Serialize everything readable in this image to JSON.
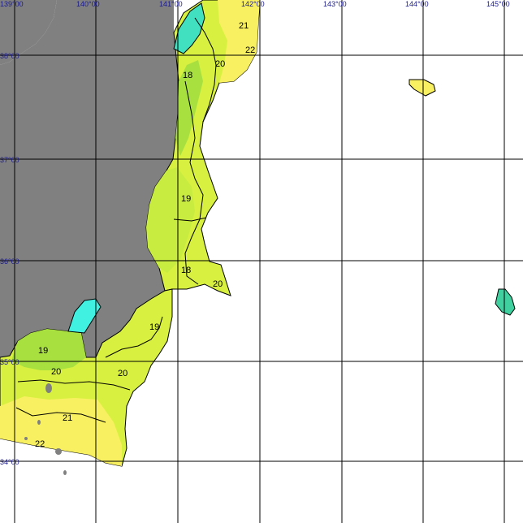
{
  "map": {
    "longitude_labels": [
      "139°00",
      "140°00",
      "141°00",
      "142°00",
      "143°00",
      "144°00",
      "145°00"
    ],
    "latitude_labels": [
      "38°00",
      "37°00",
      "36°00",
      "35°00",
      "34°00"
    ],
    "isotherm_labels": [
      "21",
      "22",
      "20",
      "18",
      "19",
      "18",
      "20",
      "19",
      "19",
      "20",
      "20",
      "21",
      "22"
    ],
    "colors": {
      "land": "#808080",
      "ocean_background": "#ffffff",
      "grid": "#000000",
      "label_text": "#1a1a8c",
      "sst_18": "#40e0c0",
      "sst_19": "#a8e040",
      "sst_20": "#d8f040",
      "sst_21": "#eef048",
      "sst_22": "#f8f060",
      "sst_cold": "#40f0e0"
    }
  }
}
